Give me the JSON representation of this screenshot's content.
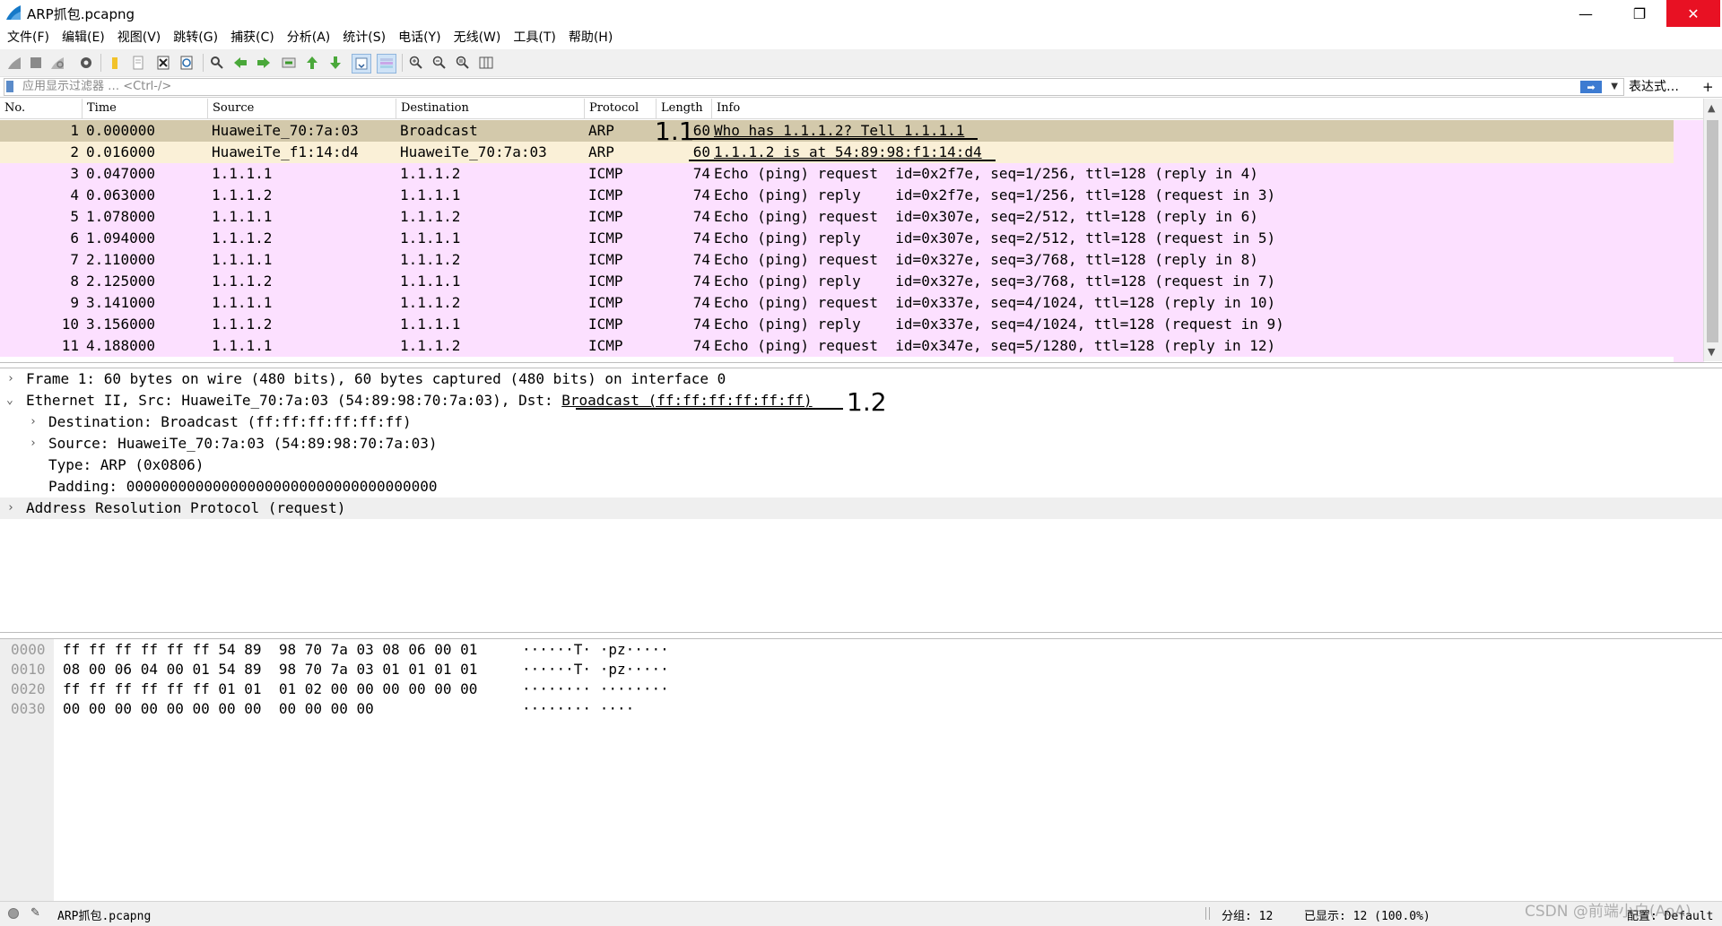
{
  "window": {
    "title": "ARP抓包.pcapng",
    "minimize": "—",
    "restore": "❐",
    "close": "✕"
  },
  "menu": [
    "文件(F)",
    "编辑(E)",
    "视图(V)",
    "跳转(G)",
    "捕获(C)",
    "分析(A)",
    "统计(S)",
    "电话(Y)",
    "无线(W)",
    "工具(T)",
    "帮助(H)"
  ],
  "filter": {
    "placeholder": "应用显示过滤器 … <Ctrl-/>",
    "apply_icon": "arrow-right-icon",
    "expression_label": "表达式…",
    "add_label": "+"
  },
  "packet_list": {
    "columns": [
      "No.",
      "Time",
      "Source",
      "Destination",
      "Protocol",
      "Length",
      "Info"
    ],
    "rows": [
      {
        "no": "1",
        "time": "0.000000",
        "source": "HuaweiTe_70:7a:03",
        "destination": "Broadcast",
        "protocol": "ARP",
        "length": "60",
        "info": "Who has 1.1.1.2? Tell 1.1.1.1"
      },
      {
        "no": "2",
        "time": "0.016000",
        "source": "HuaweiTe_f1:14:d4",
        "destination": "HuaweiTe_70:7a:03",
        "protocol": "ARP",
        "length": "60",
        "info": "1.1.1.2 is at 54:89:98:f1:14:d4"
      },
      {
        "no": "3",
        "time": "0.047000",
        "source": "1.1.1.1",
        "destination": "1.1.1.2",
        "protocol": "ICMP",
        "length": "74",
        "info": "Echo (ping) request  id=0x2f7e, seq=1/256, ttl=128 (reply in 4)"
      },
      {
        "no": "4",
        "time": "0.063000",
        "source": "1.1.1.2",
        "destination": "1.1.1.1",
        "protocol": "ICMP",
        "length": "74",
        "info": "Echo (ping) reply    id=0x2f7e, seq=1/256, ttl=128 (request in 3)"
      },
      {
        "no": "5",
        "time": "1.078000",
        "source": "1.1.1.1",
        "destination": "1.1.1.2",
        "protocol": "ICMP",
        "length": "74",
        "info": "Echo (ping) request  id=0x307e, seq=2/512, ttl=128 (reply in 6)"
      },
      {
        "no": "6",
        "time": "1.094000",
        "source": "1.1.1.2",
        "destination": "1.1.1.1",
        "protocol": "ICMP",
        "length": "74",
        "info": "Echo (ping) reply    id=0x307e, seq=2/512, ttl=128 (request in 5)"
      },
      {
        "no": "7",
        "time": "2.110000",
        "source": "1.1.1.1",
        "destination": "1.1.1.2",
        "protocol": "ICMP",
        "length": "74",
        "info": "Echo (ping) request  id=0x327e, seq=3/768, ttl=128 (reply in 8)"
      },
      {
        "no": "8",
        "time": "2.125000",
        "source": "1.1.1.2",
        "destination": "1.1.1.1",
        "protocol": "ICMP",
        "length": "74",
        "info": "Echo (ping) reply    id=0x327e, seq=3/768, ttl=128 (request in 7)"
      },
      {
        "no": "9",
        "time": "3.141000",
        "source": "1.1.1.1",
        "destination": "1.1.1.2",
        "protocol": "ICMP",
        "length": "74",
        "info": "Echo (ping) request  id=0x337e, seq=4/1024, ttl=128 (reply in 10)"
      },
      {
        "no": "10",
        "time": "3.156000",
        "source": "1.1.1.2",
        "destination": "1.1.1.1",
        "protocol": "ICMP",
        "length": "74",
        "info": "Echo (ping) reply    id=0x337e, seq=4/1024, ttl=128 (request in 9)"
      },
      {
        "no": "11",
        "time": "4.188000",
        "source": "1.1.1.1",
        "destination": "1.1.1.2",
        "protocol": "ICMP",
        "length": "74",
        "info": "Echo (ping) request  id=0x347e, seq=5/1280, ttl=128 (reply in 12)"
      }
    ]
  },
  "details": {
    "frame": "Frame 1: 60 bytes on wire (480 bits), 60 bytes captured (480 bits) on interface 0",
    "ethernet_prefix": "Ethernet II, Src: HuaweiTe_70:7a:03 (54:89:98:70:7a:03), Dst: ",
    "ethernet_dst": "Broadcast (ff:ff:ff:ff:ff:ff)",
    "destination": "Destination: Broadcast (ff:ff:ff:ff:ff:ff)",
    "source": "Source: HuaweiTe_70:7a:03 (54:89:98:70:7a:03)",
    "type": "Type: ARP (0x0806)",
    "padding": "Padding: 000000000000000000000000000000000000",
    "arp": "Address Resolution Protocol (request)",
    "expanded_glyph": "⌄",
    "collapsed_glyph": "›"
  },
  "bytes": {
    "rows": [
      {
        "offset": "0000",
        "hex": "ff ff ff ff ff ff 54 89  98 70 7a 03 08 06 00 01",
        "ascii": "······T· ·pz·····"
      },
      {
        "offset": "0010",
        "hex": "08 00 06 04 00 01 54 89  98 70 7a 03 01 01 01 01",
        "ascii": "······T· ·pz·····"
      },
      {
        "offset": "0020",
        "hex": "ff ff ff ff ff ff 01 01  01 02 00 00 00 00 00 00",
        "ascii": "········ ········"
      },
      {
        "offset": "0030",
        "hex": "00 00 00 00 00 00 00 00  00 00 00 00",
        "ascii": "········ ····"
      }
    ]
  },
  "status": {
    "file": "ARP抓包.pcapng",
    "packets": "分组: 12",
    "displayed": "已显示: 12 (100.0%)",
    "profile": "配置: Default"
  },
  "annotations": {
    "label_1_1": "1.1",
    "label_1_2": "1.2"
  },
  "watermark": "CSDN @前端小白(AoA)",
  "colors": {
    "arp_selected": "#d3c9ab",
    "arp_row": "#faf0d7",
    "icmp_row": "#fce0ff",
    "close_button": "#e81123"
  }
}
